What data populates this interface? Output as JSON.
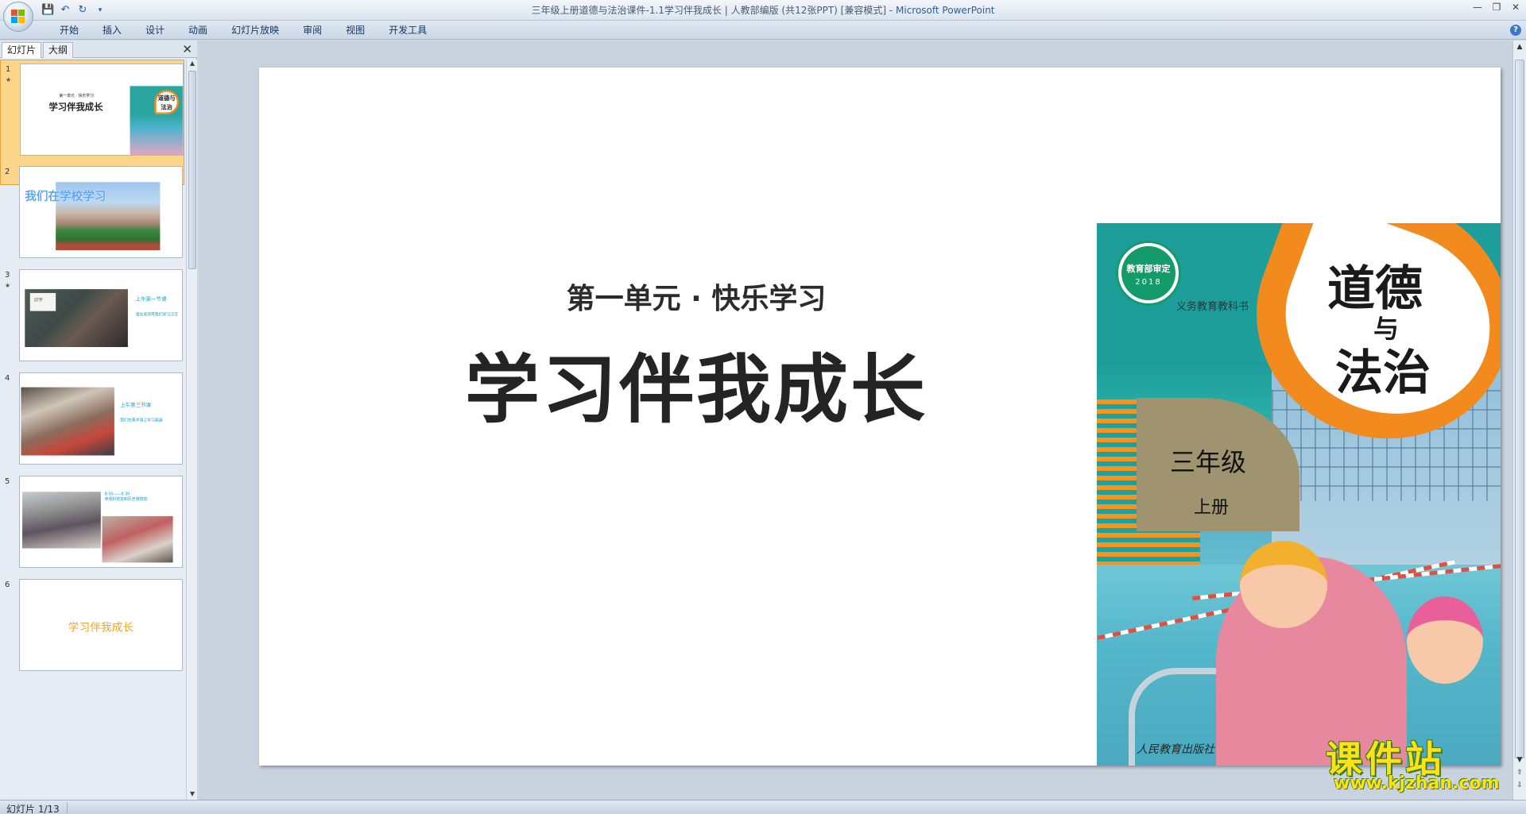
{
  "window": {
    "title": "三年级上册道德与法治课件-1.1学习伴我成长 | 人教部编版 (共12张PPT) [兼容模式]",
    "app_name": "Microsoft PowerPoint",
    "title_sep": " - "
  },
  "quick_access": {
    "save_icon": "save-icon",
    "undo_icon": "undo-icon",
    "redo_icon": "redo-icon",
    "customize_icon": "dropdown-icon"
  },
  "ribbon": {
    "tabs": [
      {
        "label": "开始"
      },
      {
        "label": "插入"
      },
      {
        "label": "设计"
      },
      {
        "label": "动画"
      },
      {
        "label": "幻灯片放映"
      },
      {
        "label": "审阅"
      },
      {
        "label": "视图"
      },
      {
        "label": "开发工具"
      }
    ],
    "help_label": "?"
  },
  "left_pane": {
    "tab_slides": "幻灯片",
    "tab_outline": "大纲",
    "close_label": "✕",
    "thumbnails": [
      {
        "num": "1",
        "sub": "第一单元 · 快乐学习",
        "title": "学习伴我成长",
        "book_label": "道德与法治"
      },
      {
        "num": "2",
        "text": "我们在学校学习"
      },
      {
        "num": "3",
        "heading": "上午第一节课",
        "body": "语文老师带我们学习汉字",
        "board": "识字"
      },
      {
        "num": "4",
        "heading": "上午第三节课",
        "body": "我们在美术课上学习画画"
      },
      {
        "num": "5",
        "heading": "8:00——8:30",
        "body": "参观科技馆和历史博物馆"
      },
      {
        "num": "6",
        "text": "学习伴我成长"
      }
    ]
  },
  "slide": {
    "subtitle": "第一单元 · 快乐学习",
    "title": "学习伴我成长",
    "book": {
      "seal_text": "教育部审定",
      "seal_year": "2018",
      "series": "义务教育教科书",
      "title_top": "道德",
      "title_mid": "与",
      "title_bottom": "法治",
      "grade": "三年级",
      "volume": "上册",
      "publisher": "人民教育出版社"
    }
  },
  "status": {
    "slide_count": "幻灯片 1/13"
  },
  "watermark": {
    "name": "课件站",
    "url": "www.kjzhan.com"
  },
  "colors": {
    "accent_orange": "#f28a1e",
    "teal": "#1e9e9a",
    "thumb_selected": "#fbd58a",
    "caption_blue": "#19a0c9"
  }
}
